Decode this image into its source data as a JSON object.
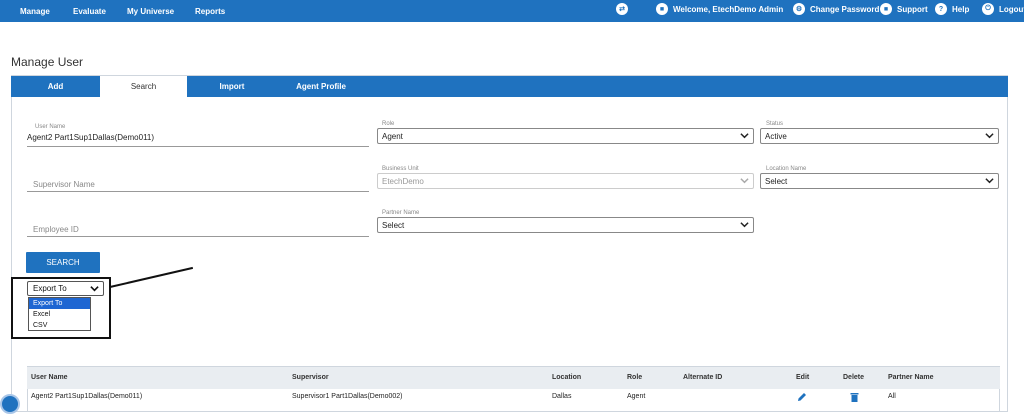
{
  "topnav": {
    "items": [
      "Manage",
      "Evaluate",
      "My Universe",
      "Reports"
    ],
    "welcome": "Welcome, EtechDemo Admin",
    "change_password": "Change Password",
    "support": "Support",
    "help": "Help",
    "logout": "Logout"
  },
  "page_title": "Manage User",
  "tabs": [
    "Add",
    "Search",
    "Import",
    "Agent Profile"
  ],
  "active_tab": "Search",
  "form": {
    "user_name": {
      "label": "User Name",
      "value": "Agent2 Part1Sup1Dallas(Demo011)"
    },
    "supervisor_name": {
      "placeholder": "Supervisor Name"
    },
    "employee_id": {
      "placeholder": "Employee ID"
    },
    "role": {
      "label": "Role",
      "value": "Agent"
    },
    "business_unit": {
      "label": "Business Unit",
      "value": "EtechDemo"
    },
    "partner_name": {
      "label": "Partner Name",
      "value": "Select"
    },
    "status": {
      "label": "Status",
      "value": "Active"
    },
    "location_name": {
      "label": "Location Name",
      "value": "Select"
    },
    "search_button": "SEARCH"
  },
  "export": {
    "selected": "Export To",
    "options": [
      "Export To",
      "Excel",
      "CSV"
    ]
  },
  "table": {
    "headers": [
      "User Name",
      "Supervisor",
      "Location",
      "Role",
      "Alternate ID",
      "Edit",
      "Delete",
      "Partner Name"
    ],
    "rows": [
      {
        "user_name": "Agent2 Part1Sup1Dallas(Demo011)",
        "supervisor": "Supervisor1 Part1Dallas(Demo002)",
        "location": "Dallas",
        "role": "Agent",
        "alternate_id": "",
        "partner_name": "All"
      }
    ]
  },
  "colors": {
    "primary": "#1f72bf",
    "highlight": "#1e66d2"
  }
}
